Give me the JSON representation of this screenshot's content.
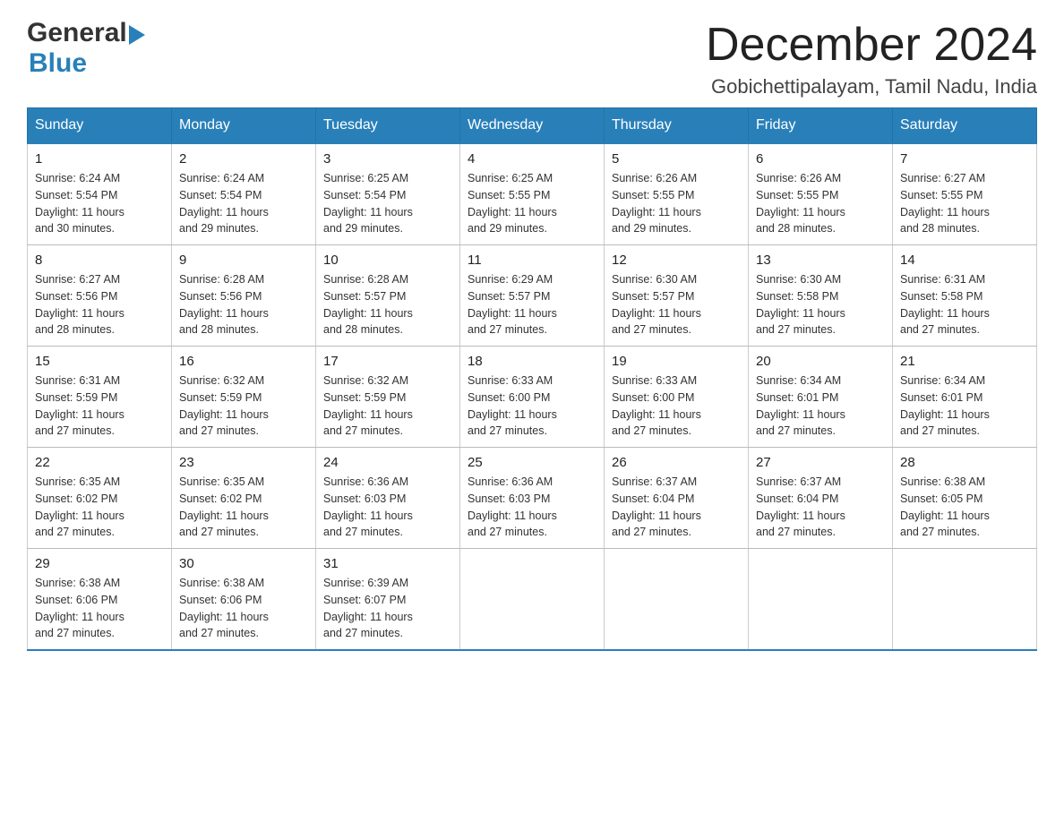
{
  "header": {
    "logo_general": "General",
    "logo_blue": "Blue",
    "month_title": "December 2024",
    "location": "Gobichettipalayam, Tamil Nadu, India"
  },
  "days_of_week": [
    "Sunday",
    "Monday",
    "Tuesday",
    "Wednesday",
    "Thursday",
    "Friday",
    "Saturday"
  ],
  "weeks": [
    [
      {
        "day": "1",
        "sunrise": "6:24 AM",
        "sunset": "5:54 PM",
        "daylight": "11 hours and 30 minutes."
      },
      {
        "day": "2",
        "sunrise": "6:24 AM",
        "sunset": "5:54 PM",
        "daylight": "11 hours and 29 minutes."
      },
      {
        "day": "3",
        "sunrise": "6:25 AM",
        "sunset": "5:54 PM",
        "daylight": "11 hours and 29 minutes."
      },
      {
        "day": "4",
        "sunrise": "6:25 AM",
        "sunset": "5:55 PM",
        "daylight": "11 hours and 29 minutes."
      },
      {
        "day": "5",
        "sunrise": "6:26 AM",
        "sunset": "5:55 PM",
        "daylight": "11 hours and 29 minutes."
      },
      {
        "day": "6",
        "sunrise": "6:26 AM",
        "sunset": "5:55 PM",
        "daylight": "11 hours and 28 minutes."
      },
      {
        "day": "7",
        "sunrise": "6:27 AM",
        "sunset": "5:55 PM",
        "daylight": "11 hours and 28 minutes."
      }
    ],
    [
      {
        "day": "8",
        "sunrise": "6:27 AM",
        "sunset": "5:56 PM",
        "daylight": "11 hours and 28 minutes."
      },
      {
        "day": "9",
        "sunrise": "6:28 AM",
        "sunset": "5:56 PM",
        "daylight": "11 hours and 28 minutes."
      },
      {
        "day": "10",
        "sunrise": "6:28 AM",
        "sunset": "5:57 PM",
        "daylight": "11 hours and 28 minutes."
      },
      {
        "day": "11",
        "sunrise": "6:29 AM",
        "sunset": "5:57 PM",
        "daylight": "11 hours and 27 minutes."
      },
      {
        "day": "12",
        "sunrise": "6:30 AM",
        "sunset": "5:57 PM",
        "daylight": "11 hours and 27 minutes."
      },
      {
        "day": "13",
        "sunrise": "6:30 AM",
        "sunset": "5:58 PM",
        "daylight": "11 hours and 27 minutes."
      },
      {
        "day": "14",
        "sunrise": "6:31 AM",
        "sunset": "5:58 PM",
        "daylight": "11 hours and 27 minutes."
      }
    ],
    [
      {
        "day": "15",
        "sunrise": "6:31 AM",
        "sunset": "5:59 PM",
        "daylight": "11 hours and 27 minutes."
      },
      {
        "day": "16",
        "sunrise": "6:32 AM",
        "sunset": "5:59 PM",
        "daylight": "11 hours and 27 minutes."
      },
      {
        "day": "17",
        "sunrise": "6:32 AM",
        "sunset": "5:59 PM",
        "daylight": "11 hours and 27 minutes."
      },
      {
        "day": "18",
        "sunrise": "6:33 AM",
        "sunset": "6:00 PM",
        "daylight": "11 hours and 27 minutes."
      },
      {
        "day": "19",
        "sunrise": "6:33 AM",
        "sunset": "6:00 PM",
        "daylight": "11 hours and 27 minutes."
      },
      {
        "day": "20",
        "sunrise": "6:34 AM",
        "sunset": "6:01 PM",
        "daylight": "11 hours and 27 minutes."
      },
      {
        "day": "21",
        "sunrise": "6:34 AM",
        "sunset": "6:01 PM",
        "daylight": "11 hours and 27 minutes."
      }
    ],
    [
      {
        "day": "22",
        "sunrise": "6:35 AM",
        "sunset": "6:02 PM",
        "daylight": "11 hours and 27 minutes."
      },
      {
        "day": "23",
        "sunrise": "6:35 AM",
        "sunset": "6:02 PM",
        "daylight": "11 hours and 27 minutes."
      },
      {
        "day": "24",
        "sunrise": "6:36 AM",
        "sunset": "6:03 PM",
        "daylight": "11 hours and 27 minutes."
      },
      {
        "day": "25",
        "sunrise": "6:36 AM",
        "sunset": "6:03 PM",
        "daylight": "11 hours and 27 minutes."
      },
      {
        "day": "26",
        "sunrise": "6:37 AM",
        "sunset": "6:04 PM",
        "daylight": "11 hours and 27 minutes."
      },
      {
        "day": "27",
        "sunrise": "6:37 AM",
        "sunset": "6:04 PM",
        "daylight": "11 hours and 27 minutes."
      },
      {
        "day": "28",
        "sunrise": "6:38 AM",
        "sunset": "6:05 PM",
        "daylight": "11 hours and 27 minutes."
      }
    ],
    [
      {
        "day": "29",
        "sunrise": "6:38 AM",
        "sunset": "6:06 PM",
        "daylight": "11 hours and 27 minutes."
      },
      {
        "day": "30",
        "sunrise": "6:38 AM",
        "sunset": "6:06 PM",
        "daylight": "11 hours and 27 minutes."
      },
      {
        "day": "31",
        "sunrise": "6:39 AM",
        "sunset": "6:07 PM",
        "daylight": "11 hours and 27 minutes."
      },
      null,
      null,
      null,
      null
    ]
  ],
  "labels": {
    "sunrise": "Sunrise:",
    "sunset": "Sunset:",
    "daylight": "Daylight:"
  }
}
